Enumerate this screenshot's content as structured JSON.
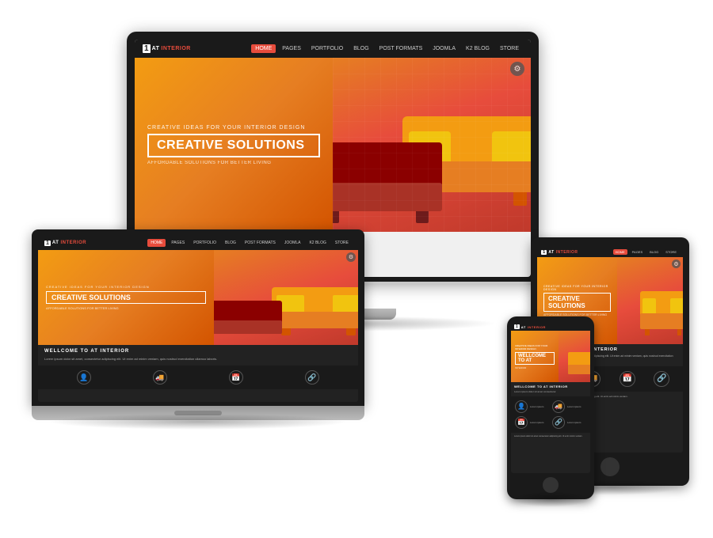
{
  "brand": {
    "name": "AT INTERIOR",
    "logo_prefix": "AT",
    "logo_accent": "INTERIOR"
  },
  "hero": {
    "subtitle": "CREATIVE IDEAS FOR YOUR INTERIOR DESIGN",
    "title": "CREATIVE SOLUTIONS",
    "tagline": "AFFORDABLE SOLUTIONS FOR BETTER LIVING"
  },
  "nav": {
    "items": [
      "HOME",
      "PAGES",
      "PORTFOLIO",
      "BLOG",
      "POST FORMATS",
      "JOOMLA",
      "K2 BLOG",
      "STORE"
    ],
    "active": "HOME"
  },
  "welcome": {
    "title": "WELLCOME TO AT INTERIOR",
    "text": "Lorem ipsum dolor sit amet, consectetur adipiscing elit. Ut enim ad minim veniam, quis nostrud exercitation ullamco laboris."
  },
  "icons": [
    "👤",
    "🚚",
    "📅",
    "🔗"
  ],
  "colors": {
    "orange": "#f39c12",
    "dark_orange": "#e67e22",
    "red": "#e74c3c",
    "dark_red": "#c0392b",
    "dark": "#1a1a1a",
    "medium_dark": "#222222"
  }
}
